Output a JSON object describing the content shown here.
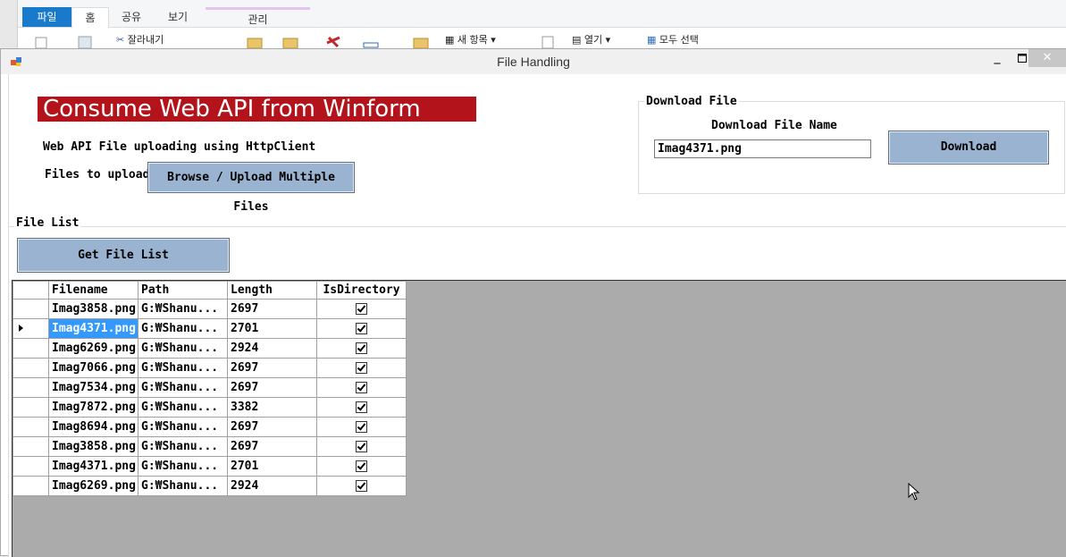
{
  "explorer": {
    "tabs": [
      "파일",
      "홈",
      "공유",
      "보기",
      "관리"
    ],
    "ribbon_items": [
      "잘라내기",
      "새 항목",
      "열기",
      "모두 선택"
    ]
  },
  "window": {
    "title": "File Handling",
    "min_glyph": "_",
    "close_glyph": "✕"
  },
  "upload": {
    "banner": "Consume Web API from Winform",
    "subtitle": "Web API File uploading using HttpClient",
    "files_label": "Files to upload:",
    "browse_button": "Browse / Upload Multiple Files"
  },
  "download": {
    "group_title": "Download File",
    "name_label": "Download File Name",
    "name_value": "Imag4371.png",
    "button": "Download"
  },
  "file_list": {
    "group_title": "File List",
    "get_button": "Get File List",
    "columns": [
      "Filename",
      "Path",
      "Length",
      "IsDirectory"
    ],
    "rows": [
      {
        "filename": "Imag3858.png",
        "path": "G:₩Shanu...",
        "length": "2697",
        "is_directory": true
      },
      {
        "filename": "Imag4371.png",
        "path": "G:₩Shanu...",
        "length": "2701",
        "is_directory": true
      },
      {
        "filename": "Imag6269.png",
        "path": "G:₩Shanu...",
        "length": "2924",
        "is_directory": true
      },
      {
        "filename": "Imag7066.png",
        "path": "G:₩Shanu...",
        "length": "2697",
        "is_directory": true
      },
      {
        "filename": "Imag7534.png",
        "path": "G:₩Shanu...",
        "length": "2697",
        "is_directory": true
      },
      {
        "filename": "Imag7872.png",
        "path": "G:₩Shanu...",
        "length": "3382",
        "is_directory": true
      },
      {
        "filename": "Imag8694.png",
        "path": "G:₩Shanu...",
        "length": "2697",
        "is_directory": true
      },
      {
        "filename": "Imag3858.png",
        "path": "G:₩Shanu...",
        "length": "2697",
        "is_directory": true
      },
      {
        "filename": "Imag4371.png",
        "path": "G:₩Shanu...",
        "length": "2701",
        "is_directory": true
      },
      {
        "filename": "Imag6269.png",
        "path": "G:₩Shanu...",
        "length": "2924",
        "is_directory": true
      }
    ],
    "selected_row": 1
  },
  "colors": {
    "banner_bg": "#b3141b",
    "button_bg": "#9ab3d0",
    "selection": "#3399ff",
    "grid_bg": "#ababab"
  }
}
